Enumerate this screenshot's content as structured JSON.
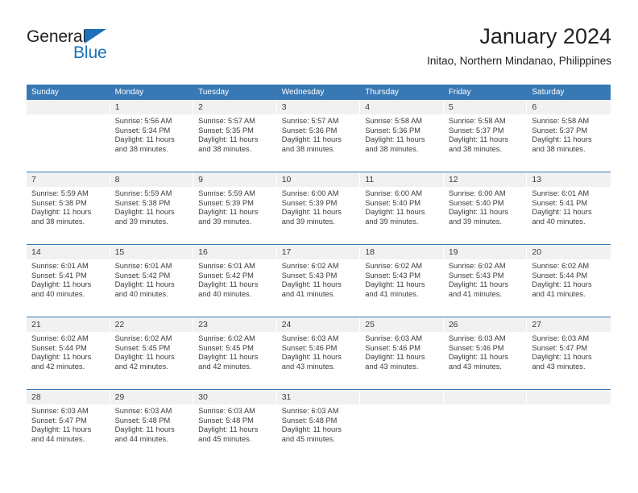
{
  "brand": {
    "name_part1": "General",
    "name_part2": "Blue",
    "triangle_icon": "triangle-icon",
    "color_primary": "#1d71b8",
    "color_text": "#231f20"
  },
  "header": {
    "title": "January 2024",
    "subtitle": "Initao, Northern Mindanao, Philippines"
  },
  "calendar": {
    "header_bg": "#3878b4",
    "daynum_bg": "#f1f1f1",
    "weekday_headers": [
      "Sunday",
      "Monday",
      "Tuesday",
      "Wednesday",
      "Thursday",
      "Friday",
      "Saturday"
    ],
    "weeks": [
      [
        {
          "day": "",
          "lines": []
        },
        {
          "day": "1",
          "lines": [
            "Sunrise: 5:56 AM",
            "Sunset: 5:34 PM",
            "Daylight: 11 hours",
            "and 38 minutes."
          ]
        },
        {
          "day": "2",
          "lines": [
            "Sunrise: 5:57 AM",
            "Sunset: 5:35 PM",
            "Daylight: 11 hours",
            "and 38 minutes."
          ]
        },
        {
          "day": "3",
          "lines": [
            "Sunrise: 5:57 AM",
            "Sunset: 5:36 PM",
            "Daylight: 11 hours",
            "and 38 minutes."
          ]
        },
        {
          "day": "4",
          "lines": [
            "Sunrise: 5:58 AM",
            "Sunset: 5:36 PM",
            "Daylight: 11 hours",
            "and 38 minutes."
          ]
        },
        {
          "day": "5",
          "lines": [
            "Sunrise: 5:58 AM",
            "Sunset: 5:37 PM",
            "Daylight: 11 hours",
            "and 38 minutes."
          ]
        },
        {
          "day": "6",
          "lines": [
            "Sunrise: 5:58 AM",
            "Sunset: 5:37 PM",
            "Daylight: 11 hours",
            "and 38 minutes."
          ]
        }
      ],
      [
        {
          "day": "7",
          "lines": [
            "Sunrise: 5:59 AM",
            "Sunset: 5:38 PM",
            "Daylight: 11 hours",
            "and 38 minutes."
          ]
        },
        {
          "day": "8",
          "lines": [
            "Sunrise: 5:59 AM",
            "Sunset: 5:38 PM",
            "Daylight: 11 hours",
            "and 39 minutes."
          ]
        },
        {
          "day": "9",
          "lines": [
            "Sunrise: 5:59 AM",
            "Sunset: 5:39 PM",
            "Daylight: 11 hours",
            "and 39 minutes."
          ]
        },
        {
          "day": "10",
          "lines": [
            "Sunrise: 6:00 AM",
            "Sunset: 5:39 PM",
            "Daylight: 11 hours",
            "and 39 minutes."
          ]
        },
        {
          "day": "11",
          "lines": [
            "Sunrise: 6:00 AM",
            "Sunset: 5:40 PM",
            "Daylight: 11 hours",
            "and 39 minutes."
          ]
        },
        {
          "day": "12",
          "lines": [
            "Sunrise: 6:00 AM",
            "Sunset: 5:40 PM",
            "Daylight: 11 hours",
            "and 39 minutes."
          ]
        },
        {
          "day": "13",
          "lines": [
            "Sunrise: 6:01 AM",
            "Sunset: 5:41 PM",
            "Daylight: 11 hours",
            "and 40 minutes."
          ]
        }
      ],
      [
        {
          "day": "14",
          "lines": [
            "Sunrise: 6:01 AM",
            "Sunset: 5:41 PM",
            "Daylight: 11 hours",
            "and 40 minutes."
          ]
        },
        {
          "day": "15",
          "lines": [
            "Sunrise: 6:01 AM",
            "Sunset: 5:42 PM",
            "Daylight: 11 hours",
            "and 40 minutes."
          ]
        },
        {
          "day": "16",
          "lines": [
            "Sunrise: 6:01 AM",
            "Sunset: 5:42 PM",
            "Daylight: 11 hours",
            "and 40 minutes."
          ]
        },
        {
          "day": "17",
          "lines": [
            "Sunrise: 6:02 AM",
            "Sunset: 5:43 PM",
            "Daylight: 11 hours",
            "and 41 minutes."
          ]
        },
        {
          "day": "18",
          "lines": [
            "Sunrise: 6:02 AM",
            "Sunset: 5:43 PM",
            "Daylight: 11 hours",
            "and 41 minutes."
          ]
        },
        {
          "day": "19",
          "lines": [
            "Sunrise: 6:02 AM",
            "Sunset: 5:43 PM",
            "Daylight: 11 hours",
            "and 41 minutes."
          ]
        },
        {
          "day": "20",
          "lines": [
            "Sunrise: 6:02 AM",
            "Sunset: 5:44 PM",
            "Daylight: 11 hours",
            "and 41 minutes."
          ]
        }
      ],
      [
        {
          "day": "21",
          "lines": [
            "Sunrise: 6:02 AM",
            "Sunset: 5:44 PM",
            "Daylight: 11 hours",
            "and 42 minutes."
          ]
        },
        {
          "day": "22",
          "lines": [
            "Sunrise: 6:02 AM",
            "Sunset: 5:45 PM",
            "Daylight: 11 hours",
            "and 42 minutes."
          ]
        },
        {
          "day": "23",
          "lines": [
            "Sunrise: 6:02 AM",
            "Sunset: 5:45 PM",
            "Daylight: 11 hours",
            "and 42 minutes."
          ]
        },
        {
          "day": "24",
          "lines": [
            "Sunrise: 6:03 AM",
            "Sunset: 5:46 PM",
            "Daylight: 11 hours",
            "and 43 minutes."
          ]
        },
        {
          "day": "25",
          "lines": [
            "Sunrise: 6:03 AM",
            "Sunset: 5:46 PM",
            "Daylight: 11 hours",
            "and 43 minutes."
          ]
        },
        {
          "day": "26",
          "lines": [
            "Sunrise: 6:03 AM",
            "Sunset: 5:46 PM",
            "Daylight: 11 hours",
            "and 43 minutes."
          ]
        },
        {
          "day": "27",
          "lines": [
            "Sunrise: 6:03 AM",
            "Sunset: 5:47 PM",
            "Daylight: 11 hours",
            "and 43 minutes."
          ]
        }
      ],
      [
        {
          "day": "28",
          "lines": [
            "Sunrise: 6:03 AM",
            "Sunset: 5:47 PM",
            "Daylight: 11 hours",
            "and 44 minutes."
          ]
        },
        {
          "day": "29",
          "lines": [
            "Sunrise: 6:03 AM",
            "Sunset: 5:48 PM",
            "Daylight: 11 hours",
            "and 44 minutes."
          ]
        },
        {
          "day": "30",
          "lines": [
            "Sunrise: 6:03 AM",
            "Sunset: 5:48 PM",
            "Daylight: 11 hours",
            "and 45 minutes."
          ]
        },
        {
          "day": "31",
          "lines": [
            "Sunrise: 6:03 AM",
            "Sunset: 5:48 PM",
            "Daylight: 11 hours",
            "and 45 minutes."
          ]
        },
        {
          "day": "",
          "lines": []
        },
        {
          "day": "",
          "lines": []
        },
        {
          "day": "",
          "lines": []
        }
      ]
    ]
  }
}
